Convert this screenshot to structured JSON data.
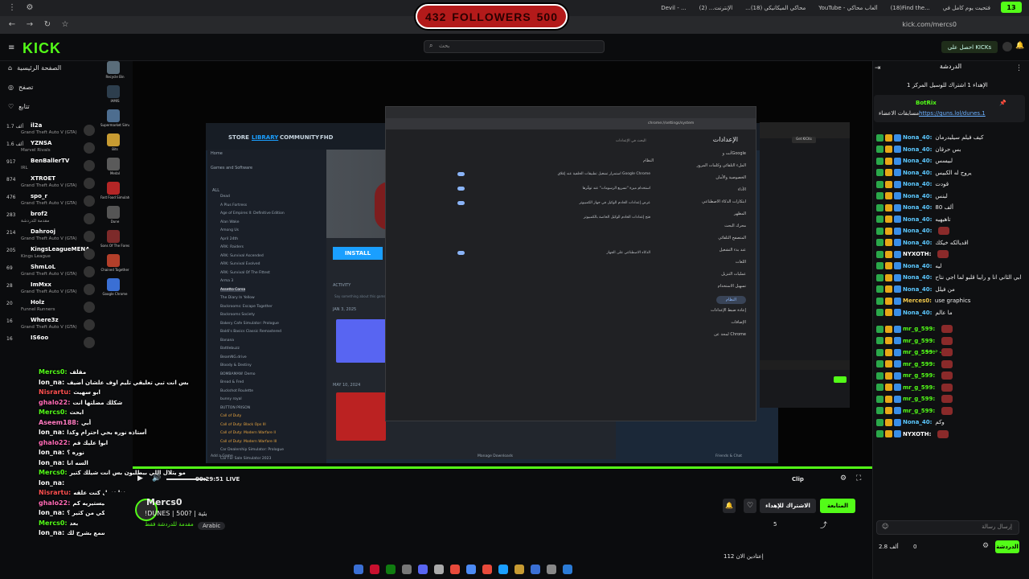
{
  "browser": {
    "tabs": [
      "Devil - ...",
      "(2) ...الإنترنت",
      "...(18) محاكي الميكانيكي",
      "YouTube - ألعاب محاكي",
      "(18)Find the...",
      "فتحيت يوم كامل في"
    ],
    "url": "kick.com/mercs0",
    "top_badge": "13"
  },
  "goal": {
    "current": "432",
    "label": "FOLLOWERS",
    "target": "500"
  },
  "header": {
    "logo": "KICK",
    "search_placeholder": "بحث",
    "get_kicks": "احصل على KICKs"
  },
  "nav": {
    "home": "الصفحة الرئيسية",
    "browse": "تصفح",
    "following": "تتابع"
  },
  "channels": [
    {
      "name": "il2a",
      "game": "Grand Theft Auto V (GTA)",
      "viewers": "1.7 ألف"
    },
    {
      "name": "YZNSA",
      "game": "Marvel Rivals",
      "viewers": "1.6 ألف"
    },
    {
      "name": "BenBallerTV",
      "game": "IRL",
      "viewers": "917"
    },
    {
      "name": "XTROET",
      "game": "Grand Theft Auto V (GTA)",
      "viewers": "874"
    },
    {
      "name": "spo_r",
      "game": "Grand Theft Auto V (GTA)",
      "viewers": "476"
    },
    {
      "name": "brof2",
      "game": "مقدمة للدردشة",
      "viewers": "283"
    },
    {
      "name": "Dahrooj",
      "game": "Grand Theft Auto V (GTA)",
      "viewers": "214"
    },
    {
      "name": "KingsLeagueMENA",
      "game": "Kings League",
      "viewers": "205"
    },
    {
      "name": "ShmLoL",
      "game": "Grand Theft Auto V (GTA)",
      "viewers": "69"
    },
    {
      "name": "ImMxx",
      "game": "Grand Theft Auto V (GTA)",
      "viewers": "28"
    },
    {
      "name": "Holz",
      "game": "Funnel Runners",
      "viewers": "20"
    },
    {
      "name": "Where3z",
      "game": "Grand Theft Auto V (GTA)",
      "viewers": "16"
    },
    {
      "name": "IS6oo",
      "game": "",
      "viewers": "16"
    }
  ],
  "desktop_icons": [
    "Recycle Bin",
    "IAMIS",
    "Supermarket Simulator",
    "Bits",
    "Medal",
    "Fast Food Simulator",
    "Dune",
    "Sons Of The Forest",
    "Chained Together",
    "Google Chrome"
  ],
  "steam": {
    "tabs": [
      "STORE",
      "LIBRARY",
      "COMMUNITY",
      "FHD"
    ],
    "home": "Home",
    "filter": "Games and Software",
    "all_label": "ALL",
    "games": [
      "Dead",
      "A Plus Fortress",
      "Age of Empires II: Definitive Edition",
      "Alan Wake",
      "Among Us",
      "April 24th",
      "ARK: Raiders",
      "ARK: Survival Ascended",
      "ARK: Survival Evolved",
      "ARK: Survival Of The Fittest",
      "Arma 3",
      "Assetto Corsa",
      "The Diary In Yellow",
      "Backrooms: Escape Together",
      "Backrooms Society",
      "Bakery Cafe Simulator: Prologue",
      "Baldi's Basics Classic Remastered",
      "Banana",
      "Battlebuzz",
      "BeamNG.drive",
      "Bloody & Destiny",
      "BOMBAMAN! Demo",
      "Bread & Fred",
      "Buckshot Roulette",
      "bunny royal",
      "BUTTON PRISON",
      "Call of Duty",
      "Call of Duty: Black Ops III",
      "Call of Duty: Modern Warfare II",
      "Call of Duty: Modern Warfare III",
      "Car Dealership Simulator: Prologue",
      "Car For Sale Simulator 2023"
    ],
    "install": "INSTALL",
    "activity": "ACTIVITY",
    "activity_placeholder": "Say something about this game...",
    "date1": "JAN 3, 2025",
    "date2": "MAY 10, 2024",
    "add_game": "Add a Game",
    "manage_downloads": "Manage Downloads",
    "friends_chat": "Friends & Chat"
  },
  "chrome_settings": {
    "url": "chrome://settings/system",
    "title": "الإعدادات",
    "search_placeholder": "البحث في الإعدادات",
    "section": "النظام",
    "nav": [
      "أنت وGoogle",
      "الملء التلقائي وكلمات المرور",
      "الخصوصية والأمان",
      "الأداء",
      "ابتكارات الذكاء الاصطناعي",
      "المظهر",
      "محرك البحث",
      "المتصفح التلقائي",
      "عند بدء التشغيل",
      "اللغات",
      "عمليات التنزيل",
      "تسهيل الاستخدام",
      "النظام",
      "إعادة ضبط الإعدادات",
      "الإضافات",
      "لمحة عن Chrome"
    ],
    "rows": [
      "استمرار تشغيل تطبيقات الخلفية عند إغلاق Google Chrome",
      "استخدام ميزة \"تسريع الرسومات\" عند توفّرها",
      "عرض إعدادات الخادم الوكيل في جهاز الكمبيوتر",
      "فتح إعدادات الخادم الوكيل الخاصة بالكمبيوتر",
      "الذكاء الاصطناعي على الجهاز"
    ]
  },
  "overlay_chat": [
    {
      "user": "Mercs0",
      "text": "مقلف"
    },
    {
      "user": "lon_na",
      "text": "بس انت تبي تعليقي تليم اوف علشان أضيف"
    },
    {
      "user": "Nisrartu",
      "text": "ابو سهيث"
    },
    {
      "user": "ghalo22",
      "text": "شكلك مضلتها انت"
    },
    {
      "user": "Mercs0",
      "text": "ابحث"
    },
    {
      "user": "Aseem188",
      "text": "أبي"
    },
    {
      "user": "lon_na",
      "text": "أستاذه نوره بحي احترام وكذا"
    },
    {
      "user": "ghalo22",
      "text": "ابوا عليك قم"
    },
    {
      "user": "lon_na",
      "text": "نوره ؟"
    },
    {
      "user": "lon_na",
      "text": "السه انا"
    },
    {
      "user": "Mercs0",
      "text": "مو يتلال اللي بيطلبون بس انت شيلك كتير"
    },
    {
      "user": "lon_na",
      "text": ""
    },
    {
      "user": "Nisrartu",
      "text": "هذا تغول كنت علقه"
    },
    {
      "user": "ghalo22",
      "text": "يا سبحت هيستيريه كم"
    },
    {
      "user": "lon_na",
      "text": "بتحكي من كثير ؟"
    },
    {
      "user": "Mercs0",
      "text": "بعد"
    },
    {
      "user": "lon_na",
      "text": "طيب اسمع بشرح لك"
    }
  ],
  "player": {
    "time": "00:29:51",
    "live": "LIVE",
    "clip": "Clip"
  },
  "stream": {
    "streamer": "Mercs0",
    "title": "!DUNES | 500? | بثية",
    "category": "مقدمة للدردشة فقط",
    "language": "Arabic",
    "follow": "المتابعة",
    "subscribe": "الاشتراك للإهداء",
    "share": "مشاركة",
    "viewers": "5",
    "followers_label": "إعتادين الان 112"
  },
  "chat": {
    "title": "الدردشة",
    "top_notice": "الإهداء 1 اشتراك للوسيل المركز 1",
    "pinned_user": "BotRix",
    "pinned_text": "مسابقات الاعضاء",
    "pinned_link": "https://guns.lol/dunes.1",
    "new_subs": "رسائل جديدة",
    "input_placeholder": "إرسال رسالة",
    "send": "الدردشة",
    "kicks": "2.8 ألف",
    "zero": "0",
    "messages": [
      {
        "user": "Nona_40",
        "text": "كيف فيلم سيليدرمان",
        "color": "#5cc8ff"
      },
      {
        "user": "Nona_40",
        "text": "بس حرقان",
        "color": "#5cc8ff"
      },
      {
        "user": "Nona_40",
        "text": "لبيسس",
        "color": "#5cc8ff"
      },
      {
        "user": "Nona_40",
        "text": "يروح له الكبيس",
        "color": "#5cc8ff"
      },
      {
        "user": "Nona_40",
        "text": "قودت",
        "color": "#5cc8ff"
      },
      {
        "user": "Nona_40",
        "text": "لبنس",
        "color": "#5cc8ff"
      },
      {
        "user": "Nona_40",
        "text": "80 ألف",
        "color": "#5cc8ff"
      },
      {
        "user": "Nona_40",
        "text": "تاهيهيه",
        "color": "#5cc8ff"
      },
      {
        "user": "Nona_40",
        "text": "",
        "color": "#5cc8ff"
      },
      {
        "user": "Nona_40",
        "text": "اقديالكه خيكك",
        "color": "#5cc8ff"
      },
      {
        "user": "NYXOTH",
        "text": "",
        "color": "#ffffff"
      },
      {
        "user": "Nona_40",
        "text": "ليه",
        "color": "#5cc8ff"
      },
      {
        "user": "Nona_40",
        "text": "ابي الثاني انا و رايبا قلبو لما اجي نتاح",
        "color": "#5cc8ff"
      },
      {
        "user": "Nona_40",
        "text": "من فيلل",
        "color": "#5cc8ff"
      },
      {
        "user": "Merces0",
        "text": "use graphics",
        "color": "#f2c94c"
      },
      {
        "user": "Nona_40",
        "text": "ما عالم",
        "color": "#5cc8ff"
      },
      {
        "user": "mr_g_599",
        "text": "",
        "color": "#53fc18"
      },
      {
        "user": "mr_g_599",
        "text": "",
        "color": "#53fc18"
      },
      {
        "user": "mr_g_599",
        "text": "",
        "color": "#53fc18"
      },
      {
        "user": "mr_g_599",
        "text": "",
        "color": "#53fc18"
      },
      {
        "user": "mr_g_599",
        "text": "",
        "color": "#53fc18"
      },
      {
        "user": "mr_g_599",
        "text": "",
        "color": "#53fc18"
      },
      {
        "user": "mr_g_599",
        "text": "",
        "color": "#53fc18"
      },
      {
        "user": "mr_g_599",
        "text": "",
        "color": "#53fc18"
      },
      {
        "user": "Nona_40",
        "text": "وكم",
        "color": "#5cc8ff"
      },
      {
        "user": "NYXOTH",
        "text": "",
        "color": "#ffffff"
      }
    ]
  },
  "colors": {
    "kick_green": "#53fc18",
    "bg": "#0b0c0e",
    "goal_red": "#b31a1a"
  }
}
